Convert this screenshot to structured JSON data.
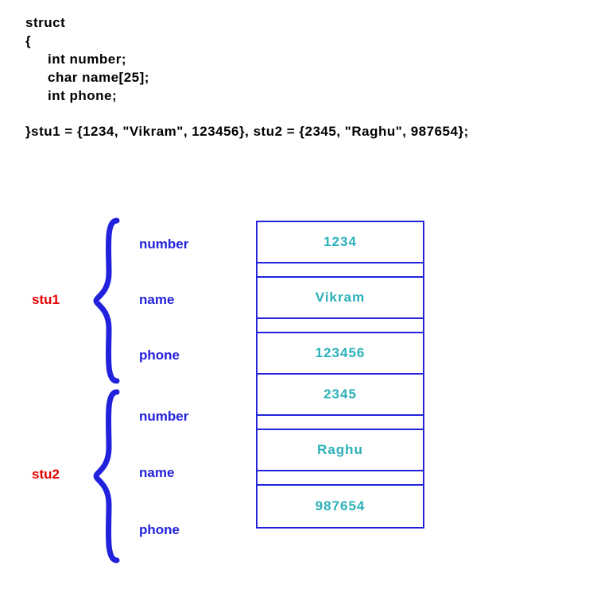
{
  "code": {
    "l1": "struct",
    "l2": "{",
    "l3": "int number;",
    "l4": "char name[25];",
    "l5": "int phone;",
    "l6": "}stu1 = {1234, \"Vikram\", 123456}, stu2 = {2345, \"Raghu\", 987654};"
  },
  "structs": [
    {
      "label": "stu1",
      "fields": [
        {
          "name": "number",
          "value": "1234"
        },
        {
          "name": "name",
          "value": "Vikram"
        },
        {
          "name": "phone",
          "value": "123456"
        }
      ]
    },
    {
      "label": "stu2",
      "fields": [
        {
          "name": "number",
          "value": "2345"
        },
        {
          "name": "name",
          "value": "Raghu"
        },
        {
          "name": "phone",
          "value": "987654"
        }
      ]
    }
  ],
  "colors": {
    "code": "#000000",
    "field": "#2222dd",
    "struct_label": "#e60000",
    "value": "#2ab0b8",
    "table_border": "#2222dd"
  }
}
